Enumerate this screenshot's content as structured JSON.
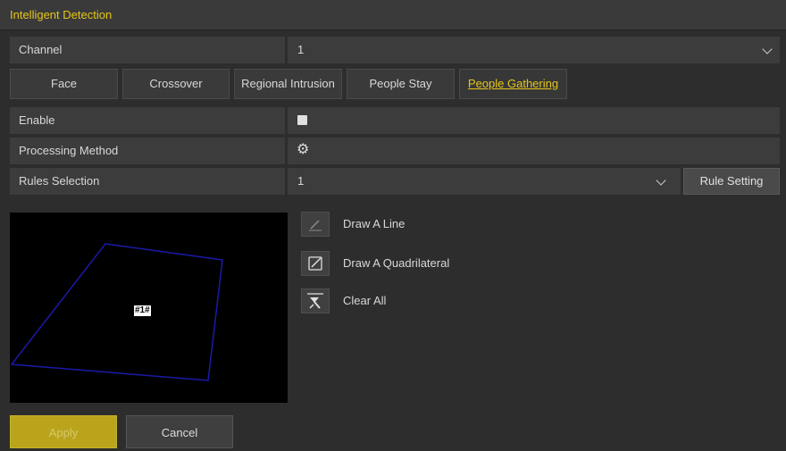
{
  "window": {
    "title": "Intelligent Detection"
  },
  "channel": {
    "label": "Channel",
    "value": "1"
  },
  "tabs": [
    {
      "label": "Face"
    },
    {
      "label": "Crossover"
    },
    {
      "label": "Regional Intrusion"
    },
    {
      "label": "People Stay"
    },
    {
      "label": "People Gathering"
    }
  ],
  "enable": {
    "label": "Enable",
    "checked": false
  },
  "processing": {
    "label": "Processing Method",
    "icon": "gear-icon"
  },
  "rules": {
    "label": "Rules Selection",
    "value": "1",
    "button_label": "Rule Setting"
  },
  "preview": {
    "area_label": "#1#",
    "outline_color": "#1a1aa8"
  },
  "tools": [
    {
      "label": "Draw A Line",
      "icon": "draw-line-icon"
    },
    {
      "label": "Draw A Quadrilateral",
      "icon": "draw-quadrilateral-icon"
    },
    {
      "label": "Clear All",
      "icon": "clear-all-icon"
    }
  ],
  "actions": {
    "apply_label": "Apply",
    "cancel_label": "Cancel"
  },
  "colors": {
    "accent": "#e6c619",
    "apply_bg": "#b9a41c",
    "panel_bg": "#2d2d2d"
  }
}
